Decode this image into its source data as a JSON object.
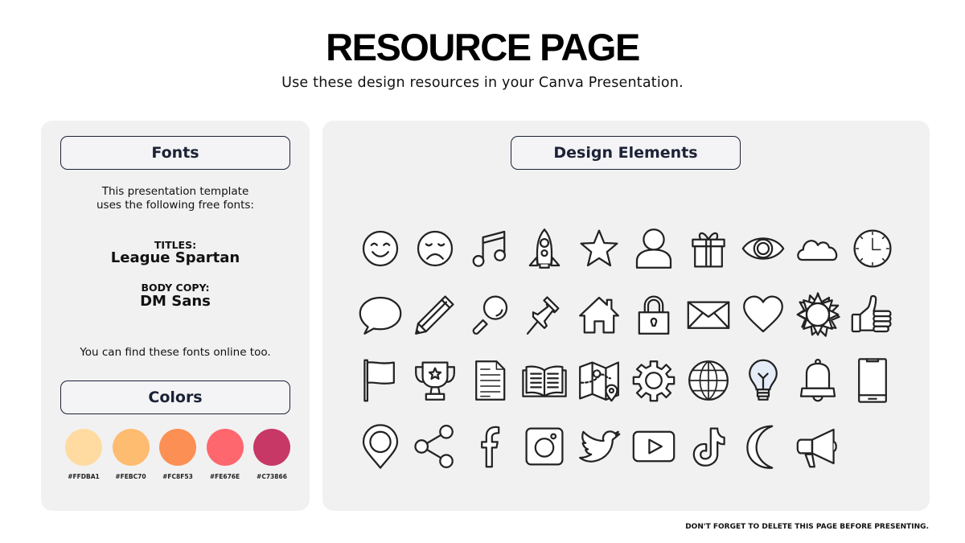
{
  "header": {
    "title": "RESOURCE PAGE",
    "subtitle": "Use these design resources in your Canva Presentation."
  },
  "fonts_panel": {
    "heading": "Fonts",
    "intro_line1": "This presentation template",
    "intro_line2": "uses the following free fonts:",
    "titles_label": "TITLES:",
    "titles_font": "League Spartan",
    "body_label": "BODY COPY:",
    "body_font": "DM Sans",
    "find_text": "You can find these fonts online too."
  },
  "colors_panel": {
    "heading": "Colors",
    "swatches": [
      {
        "hex": "#FFDBA1",
        "label": "#FFDBA1"
      },
      {
        "hex": "#FEBC70",
        "label": "#FEBC70"
      },
      {
        "hex": "#FC8F53",
        "label": "#FC8F53"
      },
      {
        "hex": "#FE676E",
        "label": "#FE676E"
      },
      {
        "hex": "#C73866",
        "label": "#C73866"
      }
    ]
  },
  "design_panel": {
    "heading": "Design Elements",
    "icons": [
      "smiley-face-icon",
      "sad-face-icon",
      "music-note-icon",
      "rocket-icon",
      "star-icon",
      "user-icon",
      "gift-icon",
      "eye-icon",
      "cloud-icon",
      "clock-icon",
      "speech-bubble-icon",
      "pencil-icon",
      "magnifying-glass-icon",
      "pushpin-icon",
      "house-icon",
      "padlock-icon",
      "envelope-icon",
      "heart-icon",
      "sun-icon",
      "thumbs-up-icon",
      "flag-icon",
      "trophy-icon",
      "document-icon",
      "open-book-icon",
      "map-icon",
      "gear-icon",
      "globe-icon",
      "lightbulb-icon",
      "bell-icon",
      "smartphone-icon",
      "location-pin-icon",
      "share-icon",
      "facebook-icon",
      "instagram-icon",
      "twitter-icon",
      "youtube-icon",
      "tiktok-icon",
      "crescent-moon-icon",
      "megaphone-icon"
    ]
  },
  "footer": {
    "note": "DON'T FORGET TO DELETE THIS PAGE BEFORE PRESENTING."
  }
}
